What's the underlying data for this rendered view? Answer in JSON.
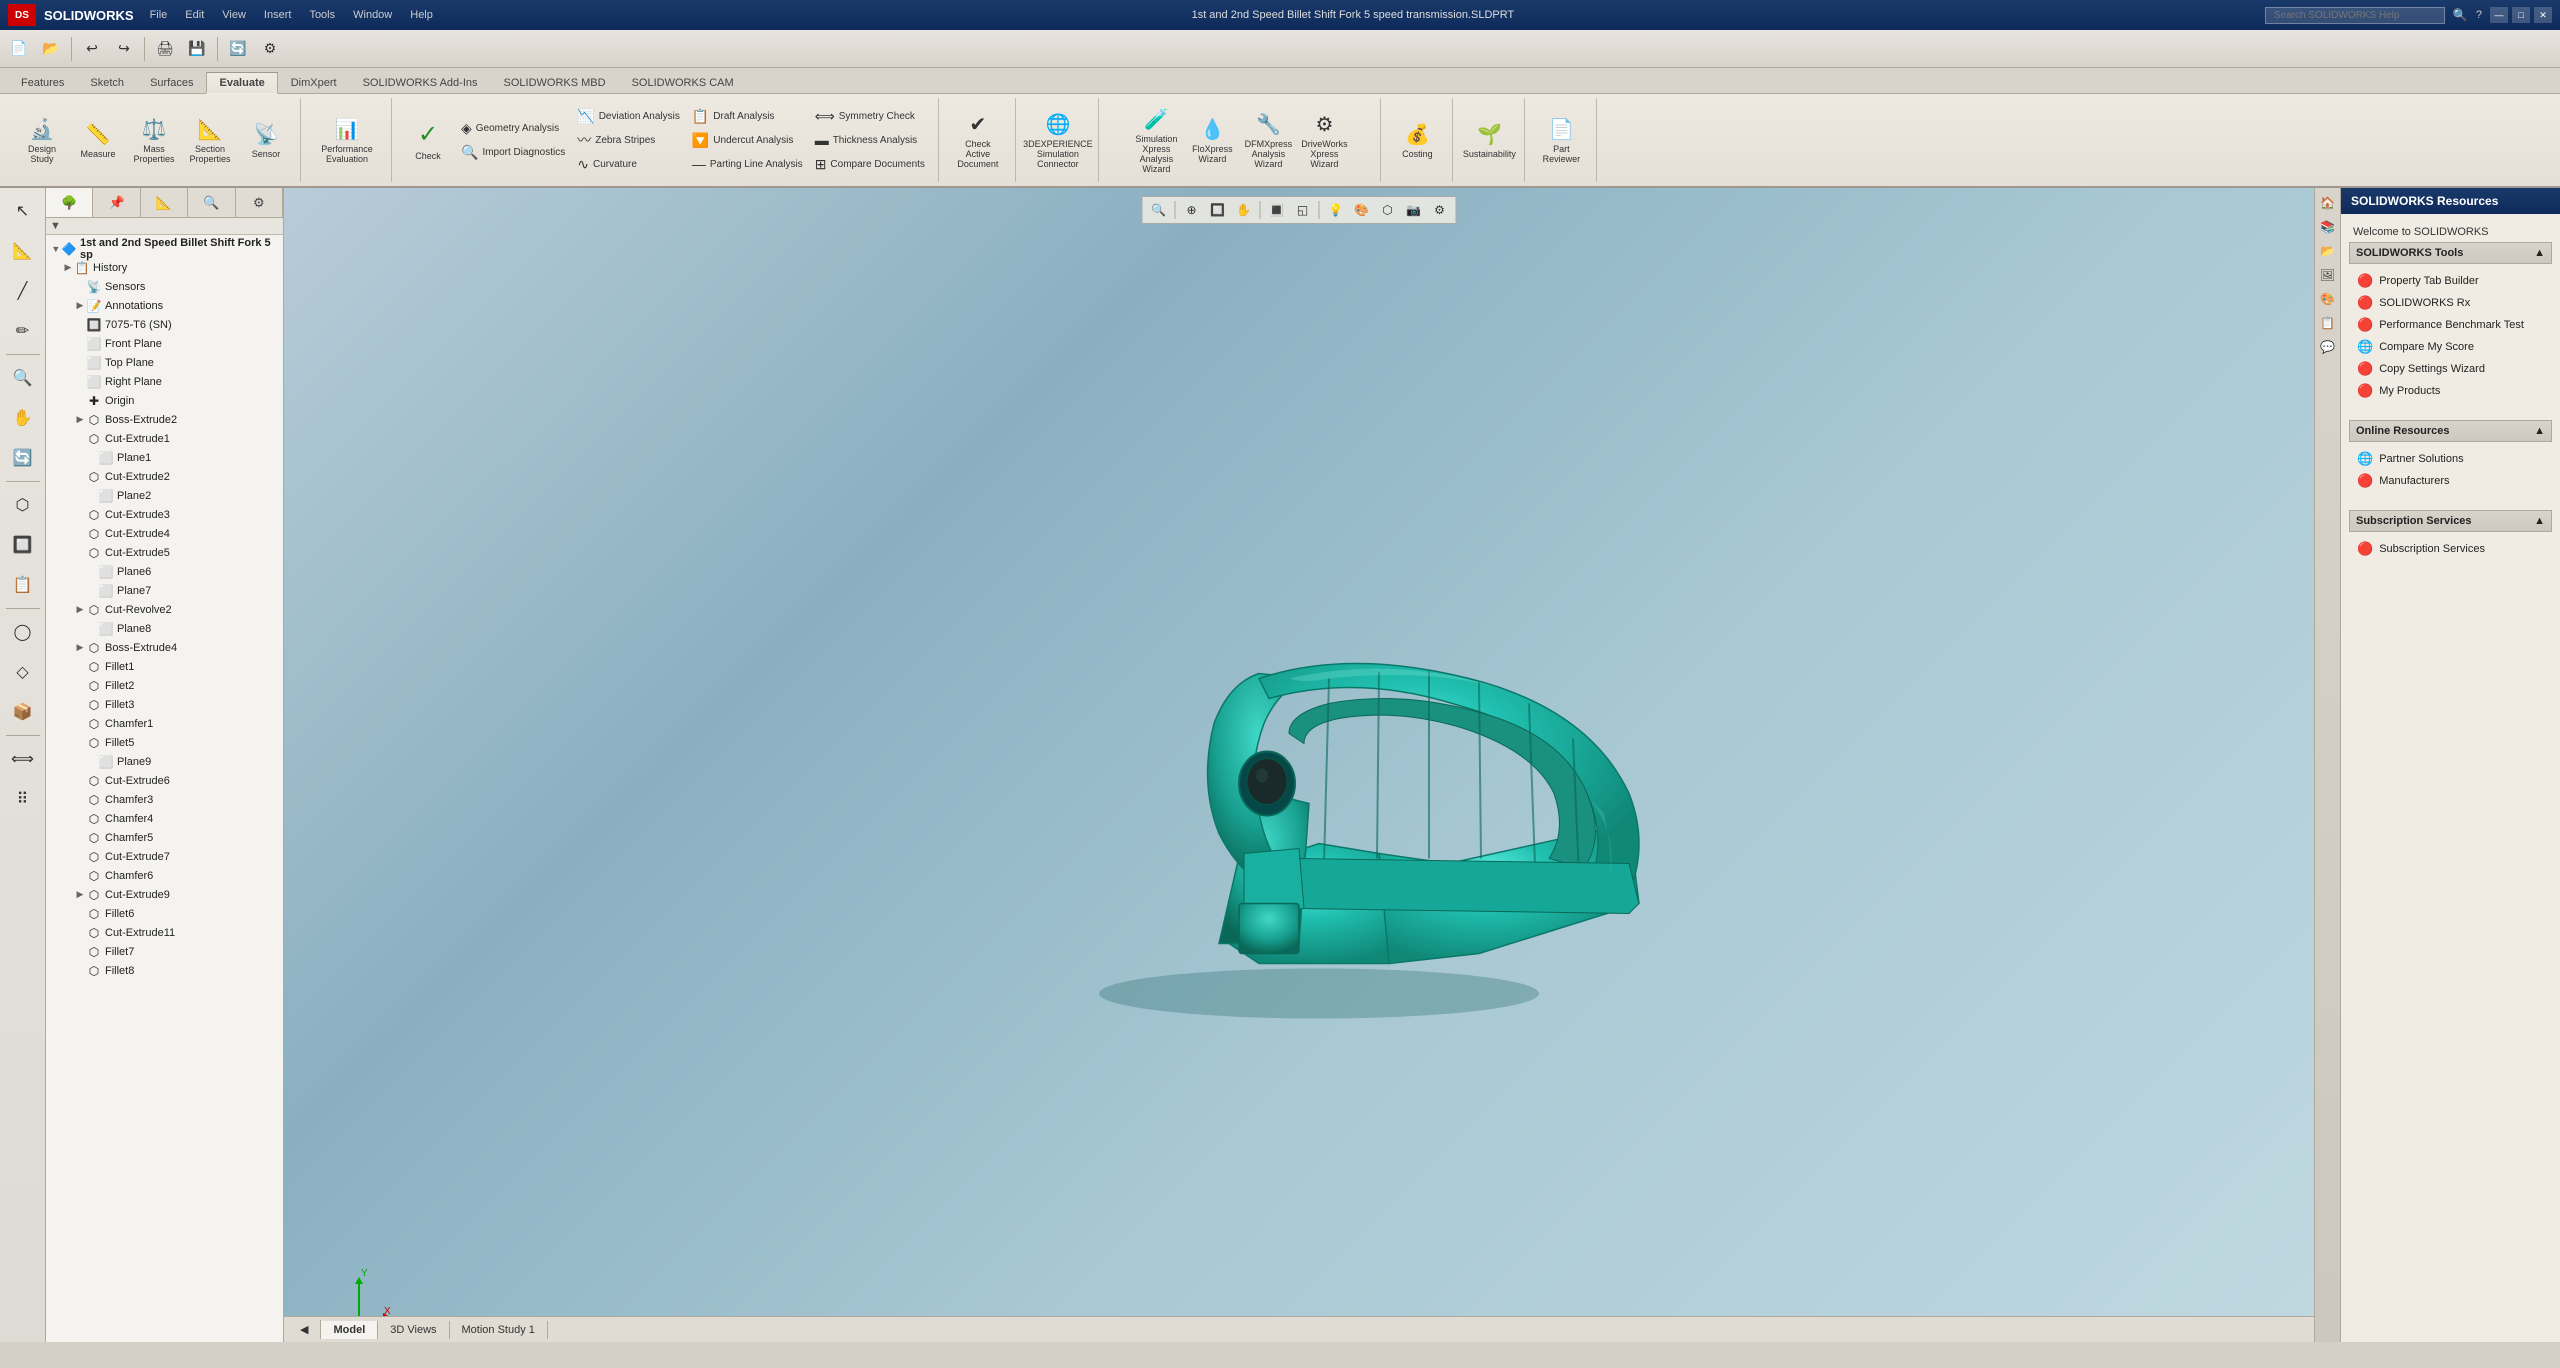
{
  "title_bar": {
    "logo": "DS",
    "app_name": "SOLIDWORKS",
    "menu_items": [
      "File",
      "Edit",
      "View",
      "Insert",
      "Tools",
      "Window",
      "Help"
    ],
    "document_title": "1st and 2nd Speed Billet Shift Fork 5 speed transmission.SLDPRT",
    "search_placeholder": "Search SOLIDWORKS Help",
    "win_controls": [
      "—",
      "□",
      "✕"
    ]
  },
  "ribbon": {
    "tabs": [
      "Features",
      "Sketch",
      "Surfaces",
      "Evaluate",
      "DimXpert",
      "SOLIDWORKS Add-Ins",
      "SOLIDWORKS MBD",
      "SOLIDWORKS CAM"
    ],
    "active_tab": "Evaluate",
    "groups": [
      {
        "name": "simulation-group",
        "label": "",
        "buttons": [
          {
            "name": "design-study",
            "label": "Design\nStudy",
            "icon": "🔬"
          },
          {
            "name": "measure",
            "label": "Measure",
            "icon": "📏"
          },
          {
            "name": "mass-properties",
            "label": "Mass\nProperties",
            "icon": "⚖️"
          },
          {
            "name": "section-properties",
            "label": "Section\nProperties",
            "icon": "📐"
          },
          {
            "name": "sensor",
            "label": "Sensor",
            "icon": "📡"
          }
        ]
      },
      {
        "name": "performance-group",
        "label": "Performance\nEvaluation",
        "buttons": [
          {
            "name": "performance-evaluation",
            "label": "Performance\nEvaluation",
            "icon": "📊"
          }
        ]
      },
      {
        "name": "analysis-group",
        "label": "",
        "buttons_left": [
          {
            "name": "check",
            "label": "Check",
            "icon": "✓",
            "large": true
          },
          {
            "name": "geometry-analysis",
            "label": "Geometry Analysis",
            "icon": "◈"
          },
          {
            "name": "import-diagnostics",
            "label": "Import Diagnostics",
            "icon": "🔍"
          }
        ],
        "buttons_right": [
          {
            "name": "deviation-analysis",
            "label": "Deviation Analysis",
            "icon": "📉"
          },
          {
            "name": "zebra-stripes",
            "label": "Zebra Stripes",
            "icon": "〰"
          },
          {
            "name": "curvature",
            "label": "Curvature",
            "icon": "∿"
          }
        ],
        "buttons_far": [
          {
            "name": "draft-analysis",
            "label": "Draft Analysis",
            "icon": "📋"
          },
          {
            "name": "undercut-analysis",
            "label": "Undercut Analysis",
            "icon": "🔽"
          },
          {
            "name": "parting-line-analysis",
            "label": "Parting Line Analysis",
            "icon": "—"
          }
        ],
        "buttons_sym": [
          {
            "name": "symmetry-check",
            "label": "Symmetry Check",
            "icon": "⟺"
          },
          {
            "name": "thickness-analysis",
            "label": "Thickness Analysis",
            "icon": "▬"
          },
          {
            "name": "compare-documents",
            "label": "Compare Documents",
            "icon": "⊞"
          }
        ]
      },
      {
        "name": "check-active-group",
        "label": "",
        "buttons": [
          {
            "name": "check-active-document",
            "label": "Check\nActive\nDocument",
            "icon": "✔"
          }
        ]
      },
      {
        "name": "3dexperience-group",
        "label": "",
        "buttons": [
          {
            "name": "3dexperience",
            "label": "3DEXPERIENCE\nSimulation\nConnector",
            "icon": "🌐"
          }
        ]
      },
      {
        "name": "simulation-wizards",
        "label": "",
        "buttons": [
          {
            "name": "simulation-xpress",
            "label": "SimulationXpress\nAnalysis Wizard",
            "icon": "🧪"
          },
          {
            "name": "floXpress",
            "label": "FloXpress\nWizard",
            "icon": "💧"
          },
          {
            "name": "dfmXpress",
            "label": "DFMXpress\nAnalysis Wizard",
            "icon": "🔧"
          },
          {
            "name": "driveworks-xpress",
            "label": "DriveWorksXpress\nWizard",
            "icon": "⚙"
          }
        ]
      },
      {
        "name": "costing-group",
        "label": "",
        "buttons": [
          {
            "name": "costing",
            "label": "Costing",
            "icon": "💰"
          }
        ]
      },
      {
        "name": "sustainability-group",
        "label": "",
        "buttons": [
          {
            "name": "sustainability",
            "label": "Sustainability",
            "icon": "🌱"
          }
        ]
      },
      {
        "name": "part-reviewer-group",
        "label": "",
        "buttons": [
          {
            "name": "part-reviewer",
            "label": "Part\nReviewer",
            "icon": "📄"
          }
        ]
      }
    ]
  },
  "left_panel": {
    "buttons": [
      "👁",
      "📐",
      "📋",
      "🔍",
      "⚙",
      "📌",
      "🔗",
      "🎨",
      "📊",
      "🔲",
      "⬜",
      "🔳"
    ]
  },
  "feature_tree": {
    "tabs": [
      "🌳",
      "📌",
      "📐",
      "🔍",
      "⚙"
    ],
    "root": "1st and 2nd Speed Billet Shift Fork 5 sp",
    "items": [
      {
        "id": "history",
        "label": "History",
        "level": 1,
        "icon": "📋",
        "has_arrow": true
      },
      {
        "id": "sensors",
        "label": "Sensors",
        "level": 2,
        "icon": "📡",
        "has_arrow": false
      },
      {
        "id": "annotations",
        "label": "Annotations",
        "level": 2,
        "icon": "📝",
        "has_arrow": true
      },
      {
        "id": "material",
        "label": "7075-T6 (SN)",
        "level": 2,
        "icon": "🔲",
        "has_arrow": false
      },
      {
        "id": "front-plane",
        "label": "Front Plane",
        "level": 2,
        "icon": "⬜",
        "has_arrow": false
      },
      {
        "id": "top-plane",
        "label": "Top Plane",
        "level": 2,
        "icon": "⬜",
        "has_arrow": false
      },
      {
        "id": "right-plane",
        "label": "Right Plane",
        "level": 2,
        "icon": "⬜",
        "has_arrow": false
      },
      {
        "id": "origin",
        "label": "Origin",
        "level": 2,
        "icon": "✚",
        "has_arrow": false
      },
      {
        "id": "boss-extrude2",
        "label": "Boss-Extrude2",
        "level": 2,
        "icon": "⬡",
        "has_arrow": true
      },
      {
        "id": "cut-extrude1",
        "label": "Cut-Extrude1",
        "level": 2,
        "icon": "⬡",
        "has_arrow": false
      },
      {
        "id": "plane1",
        "label": "Plane1",
        "level": 3,
        "icon": "⬜",
        "has_arrow": false
      },
      {
        "id": "cut-extrude2",
        "label": "Cut-Extrude2",
        "level": 2,
        "icon": "⬡",
        "has_arrow": false
      },
      {
        "id": "plane2",
        "label": "Plane2",
        "level": 3,
        "icon": "⬜",
        "has_arrow": false
      },
      {
        "id": "cut-extrude3",
        "label": "Cut-Extrude3",
        "level": 2,
        "icon": "⬡",
        "has_arrow": false
      },
      {
        "id": "cut-extrude4",
        "label": "Cut-Extrude4",
        "level": 2,
        "icon": "⬡",
        "has_arrow": false
      },
      {
        "id": "cut-extrude5",
        "label": "Cut-Extrude5",
        "level": 2,
        "icon": "⬡",
        "has_arrow": false
      },
      {
        "id": "plane6",
        "label": "Plane6",
        "level": 3,
        "icon": "⬜",
        "has_arrow": false
      },
      {
        "id": "plane7",
        "label": "Plane7",
        "level": 3,
        "icon": "⬜",
        "has_arrow": false
      },
      {
        "id": "cut-revolve2",
        "label": "Cut-Revolve2",
        "level": 2,
        "icon": "⬡",
        "has_arrow": true
      },
      {
        "id": "plane8",
        "label": "Plane8",
        "level": 3,
        "icon": "⬜",
        "has_arrow": false
      },
      {
        "id": "boss-extrude4",
        "label": "Boss-Extrude4",
        "level": 2,
        "icon": "⬡",
        "has_arrow": true
      },
      {
        "id": "fillet1",
        "label": "Fillet1",
        "level": 2,
        "icon": "⬡",
        "has_arrow": false
      },
      {
        "id": "fillet2",
        "label": "Fillet2",
        "level": 2,
        "icon": "⬡",
        "has_arrow": false
      },
      {
        "id": "fillet3",
        "label": "Fillet3",
        "level": 2,
        "icon": "⬡",
        "has_arrow": false
      },
      {
        "id": "chamfer1",
        "label": "Chamfer1",
        "level": 2,
        "icon": "⬡",
        "has_arrow": false
      },
      {
        "id": "fillet5",
        "label": "Fillet5",
        "level": 2,
        "icon": "⬡",
        "has_arrow": false
      },
      {
        "id": "plane9",
        "label": "Plane9",
        "level": 3,
        "icon": "⬜",
        "has_arrow": false
      },
      {
        "id": "cut-extrude6",
        "label": "Cut-Extrude6",
        "level": 2,
        "icon": "⬡",
        "has_arrow": false
      },
      {
        "id": "chamfer3",
        "label": "Chamfer3",
        "level": 2,
        "icon": "⬡",
        "has_arrow": false
      },
      {
        "id": "chamfer4",
        "label": "Chamfer4",
        "level": 2,
        "icon": "⬡",
        "has_arrow": false
      },
      {
        "id": "chamfer5",
        "label": "Chamfer5",
        "level": 2,
        "icon": "⬡",
        "has_arrow": false
      },
      {
        "id": "cut-extrude7",
        "label": "Cut-Extrude7",
        "level": 2,
        "icon": "⬡",
        "has_arrow": false
      },
      {
        "id": "chamfer6",
        "label": "Chamfer6",
        "level": 2,
        "icon": "⬡",
        "has_arrow": false
      },
      {
        "id": "cut-extrude9",
        "label": "Cut-Extrude9",
        "level": 2,
        "icon": "⬡",
        "has_arrow": true
      },
      {
        "id": "fillet6",
        "label": "Fillet6",
        "level": 2,
        "icon": "⬡",
        "has_arrow": false
      },
      {
        "id": "cut-extrude11",
        "label": "Cut-Extrude11",
        "level": 2,
        "icon": "⬡",
        "has_arrow": false
      },
      {
        "id": "fillet7",
        "label": "Fillet7",
        "level": 2,
        "icon": "⬡",
        "has_arrow": false
      },
      {
        "id": "fillet8",
        "label": "Fillet8",
        "level": 2,
        "icon": "⬡",
        "has_arrow": false
      }
    ]
  },
  "viewport": {
    "background_color": "#9bbfcc"
  },
  "view_toolbar": {
    "buttons": [
      "🔍",
      "⊕",
      "🔲",
      "🔳",
      "◱",
      "💡",
      "🎨",
      "⬡",
      "📷",
      "⚙"
    ]
  },
  "right_panel": {
    "title": "SOLIDWORKS Resources",
    "welcome_message": "Welcome to SOLIDWORKS",
    "sections": [
      {
        "name": "solidworks-tools",
        "label": "SOLIDWORKS Tools",
        "items": [
          {
            "name": "property-tab-builder",
            "label": "Property Tab Builder",
            "icon": "🔴"
          },
          {
            "name": "solidworks-rx",
            "label": "SOLIDWORKS Rx",
            "icon": "🔴"
          },
          {
            "name": "performance-benchmark",
            "label": "Performance Benchmark Test",
            "icon": "🔴"
          },
          {
            "name": "compare-my-score",
            "label": "Compare My Score",
            "icon": "🌐"
          },
          {
            "name": "copy-settings-wizard",
            "label": "Copy Settings Wizard",
            "icon": "🔴"
          },
          {
            "name": "my-products",
            "label": "My Products",
            "icon": "🔴"
          }
        ]
      },
      {
        "name": "online-resources",
        "label": "Online Resources",
        "items": [
          {
            "name": "partner-solutions",
            "label": "Partner Solutions",
            "icon": "🌐"
          },
          {
            "name": "manufacturers",
            "label": "Manufacturers",
            "icon": "🔴"
          }
        ]
      },
      {
        "name": "subscription-services",
        "label": "Subscription Services",
        "items": [
          {
            "name": "subscription-services-item",
            "label": "Subscription Services",
            "icon": "🔴"
          }
        ]
      }
    ]
  },
  "bottom_tabs": [
    "Model",
    "3D Views",
    "Motion Study 1"
  ],
  "active_bottom_tab": "Model",
  "status_bar": {
    "text": ""
  }
}
